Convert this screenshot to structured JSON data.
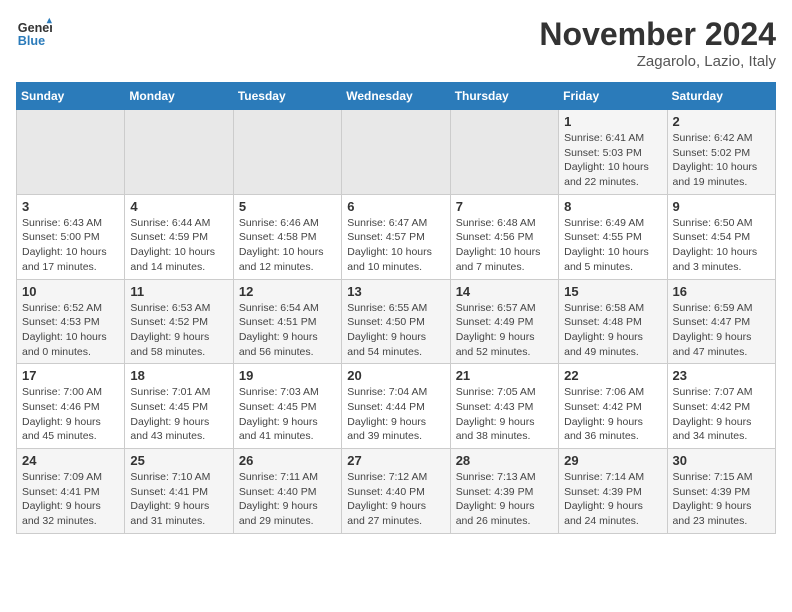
{
  "header": {
    "logo_general": "General",
    "logo_blue": "Blue",
    "month_title": "November 2024",
    "location": "Zagarolo, Lazio, Italy"
  },
  "weekdays": [
    "Sunday",
    "Monday",
    "Tuesday",
    "Wednesday",
    "Thursday",
    "Friday",
    "Saturday"
  ],
  "weeks": [
    [
      {
        "day": "",
        "info": ""
      },
      {
        "day": "",
        "info": ""
      },
      {
        "day": "",
        "info": ""
      },
      {
        "day": "",
        "info": ""
      },
      {
        "day": "",
        "info": ""
      },
      {
        "day": "1",
        "info": "Sunrise: 6:41 AM\nSunset: 5:03 PM\nDaylight: 10 hours\nand 22 minutes."
      },
      {
        "day": "2",
        "info": "Sunrise: 6:42 AM\nSunset: 5:02 PM\nDaylight: 10 hours\nand 19 minutes."
      }
    ],
    [
      {
        "day": "3",
        "info": "Sunrise: 6:43 AM\nSunset: 5:00 PM\nDaylight: 10 hours\nand 17 minutes."
      },
      {
        "day": "4",
        "info": "Sunrise: 6:44 AM\nSunset: 4:59 PM\nDaylight: 10 hours\nand 14 minutes."
      },
      {
        "day": "5",
        "info": "Sunrise: 6:46 AM\nSunset: 4:58 PM\nDaylight: 10 hours\nand 12 minutes."
      },
      {
        "day": "6",
        "info": "Sunrise: 6:47 AM\nSunset: 4:57 PM\nDaylight: 10 hours\nand 10 minutes."
      },
      {
        "day": "7",
        "info": "Sunrise: 6:48 AM\nSunset: 4:56 PM\nDaylight: 10 hours\nand 7 minutes."
      },
      {
        "day": "8",
        "info": "Sunrise: 6:49 AM\nSunset: 4:55 PM\nDaylight: 10 hours\nand 5 minutes."
      },
      {
        "day": "9",
        "info": "Sunrise: 6:50 AM\nSunset: 4:54 PM\nDaylight: 10 hours\nand 3 minutes."
      }
    ],
    [
      {
        "day": "10",
        "info": "Sunrise: 6:52 AM\nSunset: 4:53 PM\nDaylight: 10 hours\nand 0 minutes."
      },
      {
        "day": "11",
        "info": "Sunrise: 6:53 AM\nSunset: 4:52 PM\nDaylight: 9 hours\nand 58 minutes."
      },
      {
        "day": "12",
        "info": "Sunrise: 6:54 AM\nSunset: 4:51 PM\nDaylight: 9 hours\nand 56 minutes."
      },
      {
        "day": "13",
        "info": "Sunrise: 6:55 AM\nSunset: 4:50 PM\nDaylight: 9 hours\nand 54 minutes."
      },
      {
        "day": "14",
        "info": "Sunrise: 6:57 AM\nSunset: 4:49 PM\nDaylight: 9 hours\nand 52 minutes."
      },
      {
        "day": "15",
        "info": "Sunrise: 6:58 AM\nSunset: 4:48 PM\nDaylight: 9 hours\nand 49 minutes."
      },
      {
        "day": "16",
        "info": "Sunrise: 6:59 AM\nSunset: 4:47 PM\nDaylight: 9 hours\nand 47 minutes."
      }
    ],
    [
      {
        "day": "17",
        "info": "Sunrise: 7:00 AM\nSunset: 4:46 PM\nDaylight: 9 hours\nand 45 minutes."
      },
      {
        "day": "18",
        "info": "Sunrise: 7:01 AM\nSunset: 4:45 PM\nDaylight: 9 hours\nand 43 minutes."
      },
      {
        "day": "19",
        "info": "Sunrise: 7:03 AM\nSunset: 4:45 PM\nDaylight: 9 hours\nand 41 minutes."
      },
      {
        "day": "20",
        "info": "Sunrise: 7:04 AM\nSunset: 4:44 PM\nDaylight: 9 hours\nand 39 minutes."
      },
      {
        "day": "21",
        "info": "Sunrise: 7:05 AM\nSunset: 4:43 PM\nDaylight: 9 hours\nand 38 minutes."
      },
      {
        "day": "22",
        "info": "Sunrise: 7:06 AM\nSunset: 4:42 PM\nDaylight: 9 hours\nand 36 minutes."
      },
      {
        "day": "23",
        "info": "Sunrise: 7:07 AM\nSunset: 4:42 PM\nDaylight: 9 hours\nand 34 minutes."
      }
    ],
    [
      {
        "day": "24",
        "info": "Sunrise: 7:09 AM\nSunset: 4:41 PM\nDaylight: 9 hours\nand 32 minutes."
      },
      {
        "day": "25",
        "info": "Sunrise: 7:10 AM\nSunset: 4:41 PM\nDaylight: 9 hours\nand 31 minutes."
      },
      {
        "day": "26",
        "info": "Sunrise: 7:11 AM\nSunset: 4:40 PM\nDaylight: 9 hours\nand 29 minutes."
      },
      {
        "day": "27",
        "info": "Sunrise: 7:12 AM\nSunset: 4:40 PM\nDaylight: 9 hours\nand 27 minutes."
      },
      {
        "day": "28",
        "info": "Sunrise: 7:13 AM\nSunset: 4:39 PM\nDaylight: 9 hours\nand 26 minutes."
      },
      {
        "day": "29",
        "info": "Sunrise: 7:14 AM\nSunset: 4:39 PM\nDaylight: 9 hours\nand 24 minutes."
      },
      {
        "day": "30",
        "info": "Sunrise: 7:15 AM\nSunset: 4:39 PM\nDaylight: 9 hours\nand 23 minutes."
      }
    ]
  ]
}
